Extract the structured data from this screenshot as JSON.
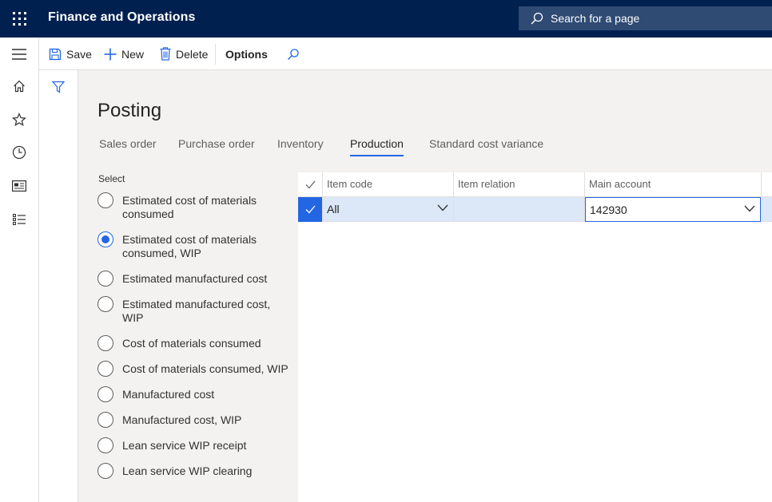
{
  "app": {
    "title": "Finance and Operations",
    "search_placeholder": "Search for a page"
  },
  "toolbar": {
    "save_label": "Save",
    "new_label": "New",
    "delete_label": "Delete",
    "options_label": "Options"
  },
  "nav": {
    "icons": [
      "menu-icon",
      "home-icon",
      "favorites-star-icon",
      "recent-clock-icon",
      "workspaces-icon",
      "modules-list-icon"
    ]
  },
  "page": {
    "title": "Posting",
    "tabs": [
      {
        "label": "Sales order",
        "active": false
      },
      {
        "label": "Purchase order",
        "active": false
      },
      {
        "label": "Inventory",
        "active": false
      },
      {
        "label": "Production",
        "active": true
      },
      {
        "label": "Standard cost variance",
        "active": false
      }
    ],
    "select_label": "Select",
    "options": [
      {
        "label": "Estimated cost of materials consumed",
        "checked": false
      },
      {
        "label": "Estimated cost of materials consumed, WIP",
        "checked": true
      },
      {
        "label": "Estimated manufactured cost",
        "checked": false
      },
      {
        "label": "Estimated manufactured cost, WIP",
        "checked": false
      },
      {
        "label": "Cost of materials consumed",
        "checked": false
      },
      {
        "label": "Cost of materials consumed, WIP",
        "checked": false
      },
      {
        "label": "Manufactured cost",
        "checked": false
      },
      {
        "label": "Manufactured cost, WIP",
        "checked": false
      },
      {
        "label": "Lean service WIP receipt",
        "checked": false
      },
      {
        "label": "Lean service WIP clearing",
        "checked": false
      }
    ]
  },
  "grid": {
    "columns": [
      "Item code",
      "Item relation",
      "Main account"
    ],
    "rows": [
      {
        "item_code": "All",
        "item_relation": "",
        "main_account": "142930",
        "selected": true
      }
    ]
  },
  "colors": {
    "topbar": "#002050",
    "accent": "#2266e3",
    "selected_row": "#dce7f8",
    "page_background": "#f3f2f1"
  }
}
